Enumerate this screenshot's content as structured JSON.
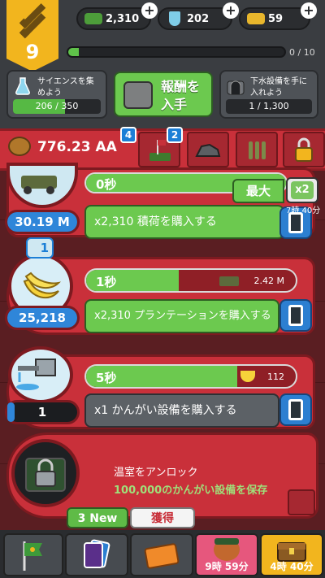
{
  "header": {
    "rank": "9",
    "resources": [
      {
        "name": "cash-bundle",
        "value": "2,310",
        "color": "#4d9d3a"
      },
      {
        "name": "science-flask",
        "value": "202",
        "color": "#7fcde8"
      },
      {
        "name": "gold-bar",
        "value": "59",
        "color": "#e8b62c"
      }
    ],
    "xp": {
      "label": "0 / 10",
      "fraction": 0.05
    },
    "quests": [
      {
        "title": "サイエンスを集\nめよう",
        "progress": "206 / 350",
        "fraction": 0.59
      },
      {
        "title": "下水設備を手に\n入れよう",
        "progress": "1 / 1,300",
        "fraction": 0.0
      }
    ],
    "reward_button": "報酬を\n入手"
  },
  "currency": {
    "money": "776.23 AA",
    "boost_badges": [
      "4",
      "2"
    ]
  },
  "upgrade": {
    "max_label": "最大",
    "multiplier": "x2",
    "timer": "7時 40分"
  },
  "rows": [
    {
      "name": "cargo",
      "count": "30.19 M",
      "time": "0秒",
      "buy": "x2,310 積荷を購入する",
      "bar_fraction": 1.0
    },
    {
      "name": "plantation",
      "badge": "1",
      "count": "25,218",
      "time": "1秒",
      "production": "2.42 M",
      "buy": "x2,310 プランテーションを購入する",
      "bar_fraction": 0.44
    },
    {
      "name": "irrigation",
      "count": "1",
      "time": "5秒",
      "production": "112",
      "buy": "x1 かんがい設備を購入する",
      "bar_fraction": 0.72
    }
  ],
  "locked": {
    "title": "温室をアンロック",
    "requirement": "100,000のかんがい設備を保存"
  },
  "nav": {
    "tags": [
      "3 New",
      "獲得"
    ],
    "timers": [
      "9時 59分",
      "4時 40分"
    ]
  }
}
